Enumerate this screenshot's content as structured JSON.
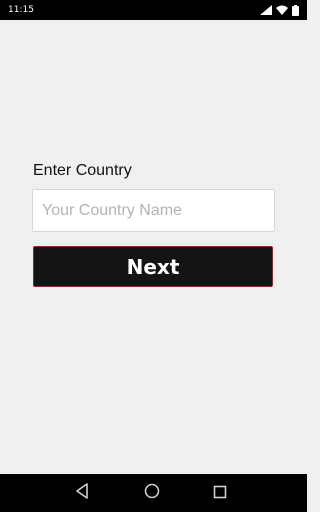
{
  "status_bar": {
    "time": "11:15",
    "icons": [
      "signal-icon",
      "wifi-icon",
      "battery-icon"
    ]
  },
  "form": {
    "label": "Enter Country",
    "input": {
      "value": "",
      "placeholder": "Your Country Name"
    },
    "next_label": "Next"
  },
  "nav_bar": {
    "buttons": [
      "back-icon",
      "home-icon",
      "recents-icon"
    ]
  },
  "colors": {
    "background": "#f0f0f0",
    "button_background": "#141414",
    "button_border": "#8a2a33",
    "placeholder_text": "#b3b3b3"
  }
}
